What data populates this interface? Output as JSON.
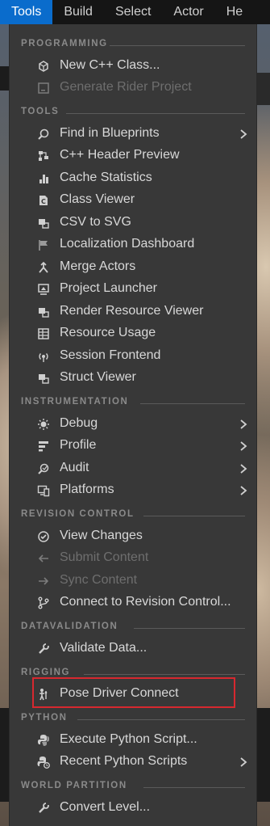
{
  "menubar": {
    "items": [
      {
        "label": "Tools",
        "active": true
      },
      {
        "label": "Build",
        "active": false
      },
      {
        "label": "Select",
        "active": false
      },
      {
        "label": "Actor",
        "active": false
      },
      {
        "label": "He",
        "active": false
      }
    ]
  },
  "colors": {
    "menu_bg": "#383838",
    "active_tab": "#0a6ccc",
    "highlight": "#d7282f",
    "section_text": "#8a8a8a"
  },
  "dropdown": {
    "sections": [
      {
        "label": "PROGRAMMING",
        "items": [
          {
            "label": "New C++ Class...",
            "icon": "class-icon",
            "enabled": true,
            "submenu": false
          },
          {
            "label": "Generate Rider Project",
            "icon": "rider-icon",
            "enabled": false,
            "submenu": false
          }
        ]
      },
      {
        "label": "TOOLS",
        "items": [
          {
            "label": "Find in Blueprints",
            "icon": "search-icon",
            "enabled": true,
            "submenu": true
          },
          {
            "label": "C++ Header Preview",
            "icon": "header-preview-icon",
            "enabled": true,
            "submenu": false
          },
          {
            "label": "Cache Statistics",
            "icon": "bar-chart-icon",
            "enabled": true,
            "submenu": false
          },
          {
            "label": "Class Viewer",
            "icon": "class-viewer-icon",
            "enabled": true,
            "submenu": false
          },
          {
            "label": "CSV to SVG",
            "icon": "csv-icon",
            "enabled": true,
            "submenu": false
          },
          {
            "label": "Localization Dashboard",
            "icon": "flag-icon",
            "enabled": true,
            "submenu": false
          },
          {
            "label": "Merge Actors",
            "icon": "merge-icon",
            "enabled": true,
            "submenu": false
          },
          {
            "label": "Project Launcher",
            "icon": "launcher-icon",
            "enabled": true,
            "submenu": false
          },
          {
            "label": "Render Resource Viewer",
            "icon": "render-resource-icon",
            "enabled": true,
            "submenu": false
          },
          {
            "label": "Resource Usage",
            "icon": "table-icon",
            "enabled": true,
            "submenu": false
          },
          {
            "label": "Session Frontend",
            "icon": "session-icon",
            "enabled": true,
            "submenu": false
          },
          {
            "label": "Struct Viewer",
            "icon": "struct-icon",
            "enabled": true,
            "submenu": false
          }
        ]
      },
      {
        "label": "INSTRUMENTATION",
        "items": [
          {
            "label": "Debug",
            "icon": "bug-icon",
            "enabled": true,
            "submenu": true
          },
          {
            "label": "Profile",
            "icon": "profile-icon",
            "enabled": true,
            "submenu": true
          },
          {
            "label": "Audit",
            "icon": "audit-icon",
            "enabled": true,
            "submenu": true
          },
          {
            "label": "Platforms",
            "icon": "platforms-icon",
            "enabled": true,
            "submenu": true
          }
        ]
      },
      {
        "label": "REVISION CONTROL",
        "items": [
          {
            "label": "View Changes",
            "icon": "check-circle-icon",
            "enabled": true,
            "submenu": false
          },
          {
            "label": "Submit Content",
            "icon": "arrow-left-icon",
            "enabled": false,
            "submenu": false
          },
          {
            "label": "Sync Content",
            "icon": "arrow-right-icon",
            "enabled": false,
            "submenu": false
          },
          {
            "label": "Connect to Revision Control...",
            "icon": "branch-icon",
            "enabled": true,
            "submenu": false
          }
        ]
      },
      {
        "label": "DATAVALIDATION",
        "items": [
          {
            "label": "Validate Data...",
            "icon": "wrench-icon",
            "enabled": true,
            "submenu": false
          }
        ]
      },
      {
        "label": "RIGGING",
        "items": [
          {
            "label": "Pose Driver Connect",
            "icon": "pose-icon",
            "enabled": true,
            "submenu": false
          }
        ]
      },
      {
        "label": "PYTHON",
        "items": [
          {
            "label": "Execute Python Script...",
            "icon": "python-icon",
            "enabled": true,
            "submenu": false
          },
          {
            "label": "Recent Python Scripts",
            "icon": "python-recent-icon",
            "enabled": true,
            "submenu": true
          }
        ]
      },
      {
        "label": "WORLD PARTITION",
        "items": [
          {
            "label": "Convert Level...",
            "icon": "wrench-icon",
            "enabled": true,
            "submenu": false
          }
        ]
      }
    ]
  }
}
